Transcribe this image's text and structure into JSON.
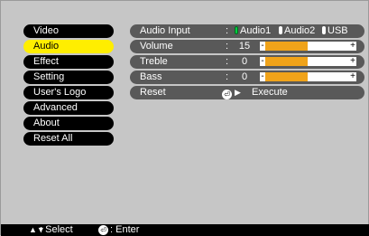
{
  "menu": {
    "items": [
      {
        "label": "Video",
        "selected": false
      },
      {
        "label": "Audio",
        "selected": true
      },
      {
        "label": "Effect",
        "selected": false
      },
      {
        "label": "Setting",
        "selected": false
      },
      {
        "label": "User's Logo",
        "selected": false
      },
      {
        "label": "Advanced",
        "selected": false
      },
      {
        "label": "About",
        "selected": false
      },
      {
        "label": "Reset All",
        "selected": false
      }
    ]
  },
  "audio_panel": {
    "audio_input": {
      "label": "Audio Input",
      "colon": ":",
      "options": [
        "Audio1",
        "Audio2",
        "USB"
      ],
      "selected": "Audio1"
    },
    "volume": {
      "label": "Volume",
      "colon": ":",
      "value": "15",
      "level": 0.5
    },
    "treble": {
      "label": "Treble",
      "colon": ":",
      "value": "0",
      "level": 0.5
    },
    "bass": {
      "label": "Bass",
      "colon": ":",
      "value": "0",
      "level": 0.5
    },
    "reset": {
      "label": "Reset",
      "action": "Execute"
    },
    "bar_minus": "-",
    "bar_plus": "+"
  },
  "footer": {
    "select_icon": "up-down-arrows-icon",
    "select_text": ": Select",
    "enter_icon": "enter-icon",
    "enter_text": ": Enter"
  },
  "colors": {
    "selected_menu": "#ffee00",
    "bar_fill": "#f0a31a",
    "radio_on": "#00d040"
  }
}
